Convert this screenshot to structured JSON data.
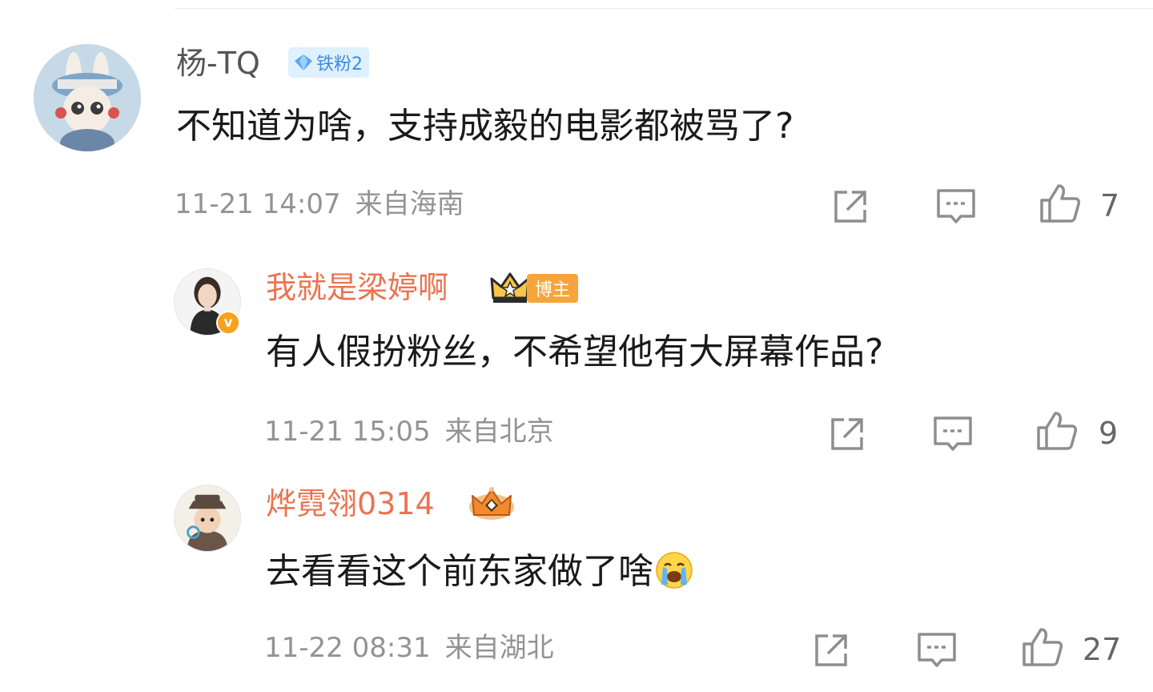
{
  "comments": [
    {
      "user": "杨-TQ",
      "fan_badge": "铁粉2",
      "text": "不知道为啥，支持成毅的电影都被骂了?",
      "time": "11-21 14:07",
      "location": "来自海南",
      "likes": "7",
      "avatar": "bunny-avatar"
    },
    {
      "user": "我就是梁婷啊",
      "author_badge": "博主",
      "verified": "v",
      "text": "有人假扮粉丝，不希望他有大屏幕作品?",
      "time": "11-21 15:05",
      "location": "来自北京",
      "likes": "9",
      "avatar": "woman-avatar"
    },
    {
      "user": "烨霓翎0314",
      "text": "去看看这个前东家做了啥",
      "emoji": "crying-face-emoji",
      "time": "11-22 08:31",
      "location": "来自湖北",
      "likes": "27",
      "avatar": "cartoon-detective-avatar"
    }
  ],
  "icons": {
    "share": "share-icon",
    "reply": "comment-icon",
    "like": "thumbs-up-icon"
  },
  "colors": {
    "username_highlight": "#eb7350",
    "username_default": "#555555",
    "meta_text": "#939393",
    "author_badge_bg": "#f6a53b",
    "fan_badge_bg": "#dff0ff",
    "fan_badge_text": "#3b8de0"
  }
}
